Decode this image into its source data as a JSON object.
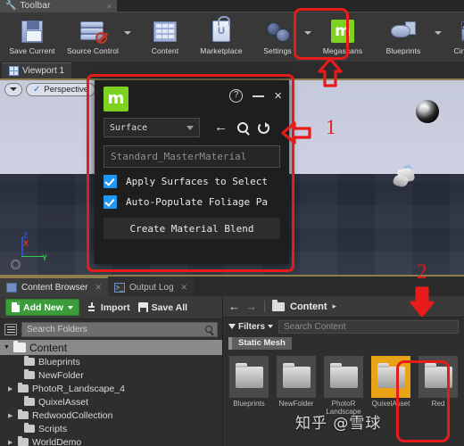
{
  "window": {
    "toolbar_tab": {
      "label": "Toolbar",
      "icon": "wrench-icon",
      "close": "×"
    }
  },
  "toolbar": {
    "buttons": [
      {
        "label": "Save Current",
        "icon": "floppy-disk-icon",
        "has_caret": false
      },
      {
        "label": "Source Control",
        "icon": "source-control-icon",
        "has_caret": true
      },
      {
        "label": "Content",
        "icon": "content-grid-icon",
        "has_caret": false
      },
      {
        "label": "Marketplace",
        "icon": "shopping-bag-icon",
        "has_caret": false
      },
      {
        "label": "Settings",
        "icon": "gears-icon",
        "has_caret": true
      },
      {
        "label": "Megascans",
        "icon": "megascans-m-icon",
        "has_caret": false
      },
      {
        "label": "Blueprints",
        "icon": "gamepad-icon",
        "has_caret": true
      },
      {
        "label": "Cinematics",
        "icon": "clapperboard-icon",
        "has_caret": true
      }
    ]
  },
  "viewport": {
    "tab_label": "Viewport 1",
    "view_mode": "Perspective",
    "axis": {
      "z": "Z",
      "x": "X",
      "y": "Y"
    }
  },
  "dialog": {
    "logo_letter": "m",
    "help": "?",
    "minimize": "—",
    "close": "×",
    "type_dropdown": "Surface",
    "icons": {
      "back": "←",
      "search": "search-icon",
      "refresh": "refresh-icon"
    },
    "material_field": "Standard_MasterMaterial",
    "checkboxes": [
      {
        "label": "Apply Surfaces to Select",
        "checked": true
      },
      {
        "label": "Auto-Populate Foliage Pa",
        "checked": true
      }
    ],
    "action_button": "Create Material Blend"
  },
  "bottom_panel": {
    "tabs": [
      {
        "label": "Content Browser",
        "active": true,
        "icon": "content-browser-icon"
      },
      {
        "label": "Output Log",
        "active": false,
        "icon": "output-log-icon"
      }
    ],
    "toolbar": {
      "add_new": "Add New",
      "import": "Import",
      "save_all": "Save All"
    },
    "folder_search_placeholder": "Search Folders",
    "tree": [
      {
        "label": "Content",
        "root": true,
        "expandable": true
      },
      {
        "label": "Blueprints",
        "root": false,
        "expandable": false
      },
      {
        "label": "NewFolder",
        "root": false,
        "expandable": false
      },
      {
        "label": "PhotoR_Landscape_4",
        "root": false,
        "expandable": true
      },
      {
        "label": "QuixelAsset",
        "root": false,
        "expandable": false
      },
      {
        "label": "RedwoodCollection",
        "root": false,
        "expandable": true
      },
      {
        "label": "Scripts",
        "root": false,
        "expandable": false
      },
      {
        "label": "WorldDemo",
        "root": false,
        "expandable": true
      }
    ],
    "breadcrumb": {
      "back": "←",
      "forward": "→",
      "path": "Content",
      "caret": "▸"
    },
    "filters_label": "Filters",
    "content_search_placeholder": "Search Content",
    "active_filter_chip": "Static Mesh",
    "assets": [
      {
        "label": "Blueprints",
        "selected": false
      },
      {
        "label": "NewFolder",
        "selected": false
      },
      {
        "label": "PhotoR Landscape",
        "selected": false
      },
      {
        "label": "QuixelAsset",
        "selected": true
      },
      {
        "label": "Red",
        "selected": false
      }
    ]
  },
  "annotations": {
    "step_one": "1",
    "step_two": "2",
    "accent_color": "#e81b1b"
  },
  "watermark": "知乎 @雪球"
}
